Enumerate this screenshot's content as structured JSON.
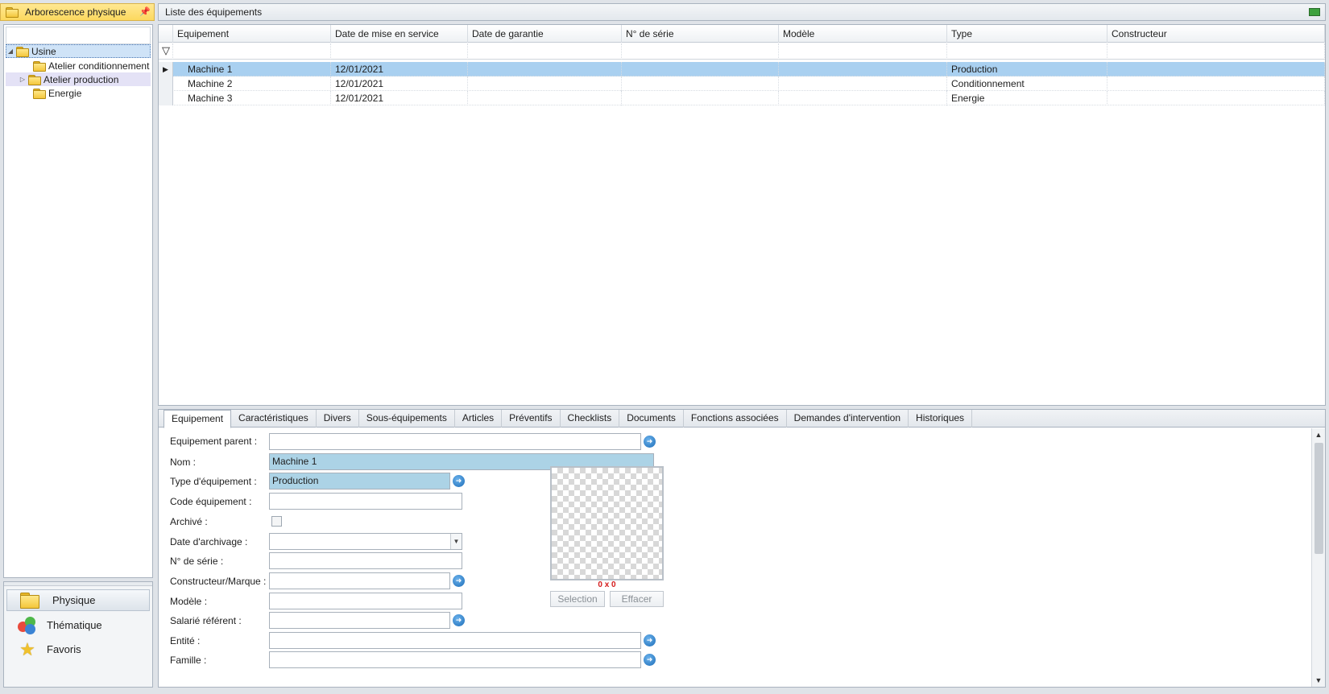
{
  "left_pane": {
    "title": "Arborescence physique",
    "tree": [
      {
        "label": "Usine"
      },
      {
        "label": "Atelier conditionnement"
      },
      {
        "label": "Atelier production"
      },
      {
        "label": "Energie"
      }
    ],
    "nav": [
      {
        "label": "Physique"
      },
      {
        "label": "Thématique"
      },
      {
        "label": "Favoris"
      }
    ]
  },
  "grid": {
    "title": "Liste des équipements",
    "columns": [
      "Equipement",
      "Date de mise en service",
      "Date de garantie",
      "N° de série",
      "Modèle",
      "Type",
      "Constructeur"
    ],
    "rows": [
      [
        "Machine 1",
        "12/01/2021",
        "",
        "",
        "",
        "Production",
        ""
      ],
      [
        "Machine 2",
        "12/01/2021",
        "",
        "",
        "",
        "Conditionnement",
        ""
      ],
      [
        "Machine 3",
        "12/01/2021",
        "",
        "",
        "",
        "Energie",
        ""
      ]
    ]
  },
  "detail": {
    "tabs": [
      "Equipement",
      "Caractéristiques",
      "Divers",
      "Sous-équipements",
      "Articles",
      "Préventifs",
      "Checklists",
      "Documents",
      "Fonctions associées",
      "Demandes d'intervention",
      "Historiques"
    ],
    "fields": {
      "parent": {
        "label": "Equipement parent :",
        "value": ""
      },
      "nom": {
        "label": "Nom :",
        "value": "Machine 1"
      },
      "type": {
        "label": "Type d'équipement :",
        "value": "Production"
      },
      "code": {
        "label": "Code équipement :",
        "value": ""
      },
      "archive": {
        "label": "Archivé :"
      },
      "date_archivage": {
        "label": "Date d'archivage :",
        "value": "  /    /"
      },
      "serie": {
        "label": "N° de série :",
        "value": ""
      },
      "constructeur": {
        "label": "Constructeur/Marque :",
        "value": ""
      },
      "modele": {
        "label": "Modèle :",
        "value": ""
      },
      "salarie": {
        "label": "Salarié référent :",
        "value": ""
      },
      "entite": {
        "label": "Entité :",
        "value": ""
      },
      "famille": {
        "label": "Famille :",
        "value": ""
      }
    },
    "image": {
      "dimensions": "0 x 0",
      "select_label": "Selection",
      "clear_label": "Effacer"
    }
  },
  "colors": {
    "selection": "#a9d0f0",
    "filled_field": "#acd3e6",
    "header_yellow": "#fcd85e",
    "dim_red": "#d41a1a"
  }
}
